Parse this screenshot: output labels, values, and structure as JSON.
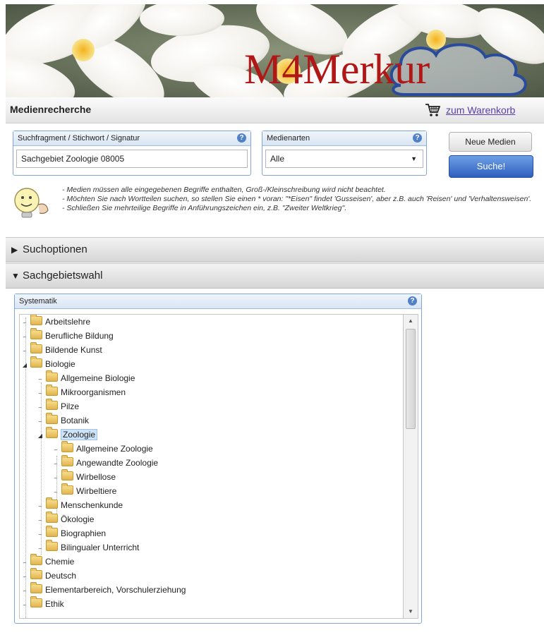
{
  "brand": {
    "logo": "M4Merkur"
  },
  "header": {
    "title": "Medienrecherche",
    "cart_link": "zum Warenkorb"
  },
  "search": {
    "fragment_label": "Suchfragment / Stichwort / Signatur",
    "fragment_value": "Sachgebiet  Zoologie 08005",
    "medien_label": "Medienarten",
    "medien_value": "Alle",
    "new_media_label": "Neue Medien",
    "search_label": "Suche!"
  },
  "hints": [
    "- Medien müssen alle eingegebenen Begriffe enthalten, Groß-/Kleinschreibung wird nicht beachtet.",
    "- Möchten Sie nach Wortteilen suchen, so stellen Sie einen * voran: \"*Eisen\" findet 'Gusseisen', aber z.B. auch 'Reisen' und 'Verhaltensweisen'.",
    "- Schließen Sie mehrteilige Begriffe in Anführungszeichen ein, z.B. \"Zweiter Weltkrieg\"."
  ],
  "sections": {
    "options": "Suchoptionen",
    "subject": "Sachgebietswahl"
  },
  "tree_title": "Systematik",
  "tree": [
    {
      "label": "Arbeitslehre"
    },
    {
      "label": "Berufliche Bildung"
    },
    {
      "label": "Bildende Kunst"
    },
    {
      "label": "Biologie"
    },
    {
      "label": "Allgemeine Biologie"
    },
    {
      "label": "Mikroorganismen"
    },
    {
      "label": "Pilze"
    },
    {
      "label": "Botanik"
    },
    {
      "label": "Zoologie"
    },
    {
      "label": "Allgemeine Zoologie"
    },
    {
      "label": "Angewandte Zoologie"
    },
    {
      "label": "Wirbellose"
    },
    {
      "label": "Wirbeltiere"
    },
    {
      "label": "Menschenkunde"
    },
    {
      "label": "Ökologie"
    },
    {
      "label": "Biographien"
    },
    {
      "label": "Bilingualer Unterricht"
    },
    {
      "label": "Chemie"
    },
    {
      "label": "Deutsch"
    },
    {
      "label": "Elementarbereich, Vorschulerziehung"
    },
    {
      "label": "Ethik"
    }
  ]
}
